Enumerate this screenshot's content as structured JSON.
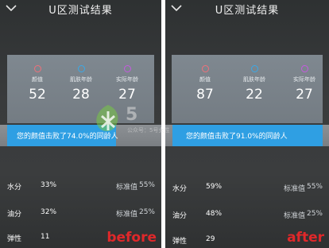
{
  "colors": {
    "ring_looks": "#f0707a",
    "ring_skin_age": "#3aa9e8",
    "ring_real_age": "#c65adf",
    "bar_fill": "#2f9fe3",
    "tag_red": "#e0282a"
  },
  "icons": {
    "back": "chevron-down-icon"
  },
  "before": {
    "title": "U区测试结果",
    "metrics": [
      {
        "label": "颜值",
        "value": "52"
      },
      {
        "label": "肌肤年龄",
        "value": "28"
      },
      {
        "label": "实际年龄",
        "value": "27"
      }
    ],
    "beat_text": "您的颜值击败了74.0%的同龄人",
    "beat_fraction": 0.74,
    "rows": [
      {
        "label": "水分",
        "value": "33%",
        "std_label": "标准值",
        "std_value": "55%"
      },
      {
        "label": "油分",
        "value": "32%",
        "std_label": "标准值",
        "std_value": "25%"
      },
      {
        "label": "弹性",
        "value": "11"
      }
    ],
    "tag": "before"
  },
  "after": {
    "title": "U区测试结果",
    "metrics": [
      {
        "label": "颜值",
        "value": "87"
      },
      {
        "label": "肌肤年龄",
        "value": "22"
      },
      {
        "label": "实际年龄",
        "value": "27"
      }
    ],
    "beat_text": "您的颜值击败了91.0%的同龄人",
    "beat_fraction": 0.91,
    "rows": [
      {
        "label": "水分",
        "value": "59%",
        "std_label": "标准值",
        "std_value": "55%"
      },
      {
        "label": "油分",
        "value": "48%",
        "std_label": "标准值",
        "std_value": "25%"
      },
      {
        "label": "弹性",
        "value": "29"
      }
    ],
    "tag": "after"
  },
  "watermark": {
    "main": "5",
    "sub": "公众号：5号女性"
  }
}
